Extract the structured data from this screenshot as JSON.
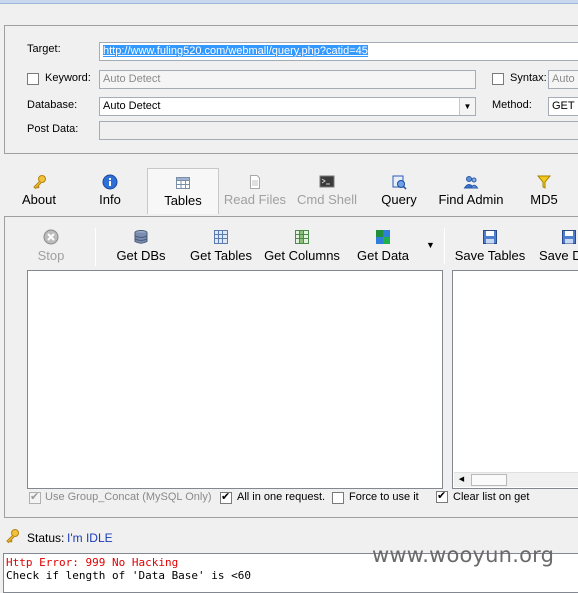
{
  "config": {
    "target_label": "Target:",
    "target_value": "http://www.fuling520.com/webmall/query.php?catid=45",
    "keyword_label": "Keyword:",
    "keyword_placeholder": "Auto Detect",
    "syntax_label": "Syntax:",
    "syntax_placeholder": "Auto",
    "database_label": "Database:",
    "database_value": "Auto Detect",
    "method_label": "Method:",
    "method_value": "GET",
    "postdata_label": "Post Data:"
  },
  "toolbar": [
    {
      "label": "About",
      "icon": "key-icon",
      "color": "#d4a020",
      "state": "normal"
    },
    {
      "label": "Info",
      "icon": "info-icon",
      "color": "#1f5fd0",
      "state": "normal"
    },
    {
      "label": "Tables",
      "icon": "table-icon",
      "color": "#7a8ea8",
      "state": "active"
    },
    {
      "label": "Read Files",
      "icon": "file-icon",
      "color": "#a8a8a8",
      "state": "disabled"
    },
    {
      "label": "Cmd Shell",
      "icon": "terminal-icon",
      "color": "#555555",
      "state": "disabled"
    },
    {
      "label": "Query",
      "icon": "query-icon",
      "color": "#2a5ab8",
      "state": "normal"
    },
    {
      "label": "Find Admin",
      "icon": "users-icon",
      "color": "#3a6ec8",
      "state": "normal"
    },
    {
      "label": "MD5",
      "icon": "md5-icon",
      "color": "#e0b000",
      "state": "normal"
    }
  ],
  "actions": {
    "stop": "Stop",
    "get_dbs": "Get DBs",
    "get_tables": "Get Tables",
    "get_columns": "Get Columns",
    "get_data": "Get Data",
    "save_tables": "Save Tables",
    "save_d": "Save D"
  },
  "options": {
    "use_group_concat": {
      "label": "Use Group_Concat (MySQL Only)",
      "checked": true,
      "enabled": false
    },
    "all_in_one": {
      "label": "All in one request.",
      "checked": true,
      "enabled": true
    },
    "force_use": {
      "label": "Force to use it",
      "checked": false,
      "enabled": true
    },
    "clear_list": {
      "label": "Clear list on get",
      "checked": true,
      "enabled": true
    }
  },
  "status": {
    "label": "Status:",
    "value": "I'm IDLE"
  },
  "log": {
    "line1": "Http Error: 999 No Hacking",
    "line2": "Check if length of 'Data Base' is <60"
  },
  "watermark": "www.wooyun.org"
}
